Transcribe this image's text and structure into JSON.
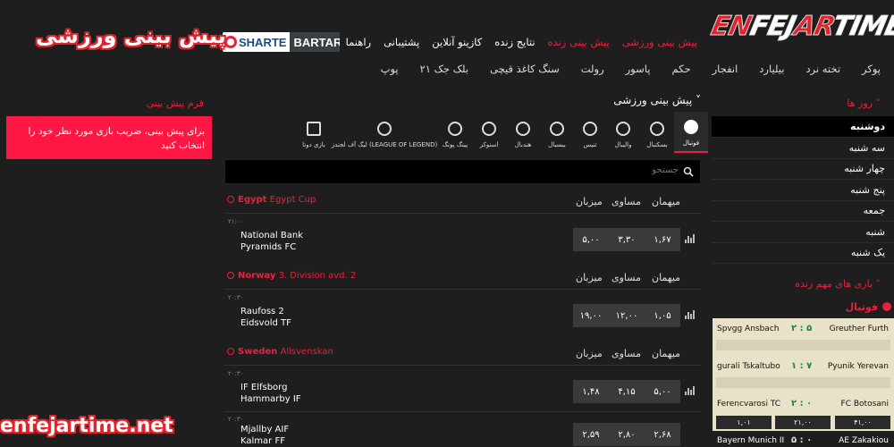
{
  "logo": {
    "part1": "EN",
    "part2": "FEJ",
    "part3": "AR",
    "part4": "TIME"
  },
  "nav_main": [
    "پیش بینی ورزشی",
    "پیش بینی زنده",
    "نتایج زنده",
    "کازینو آنلاین",
    "پشتیبانی",
    "راهنما"
  ],
  "nav_games_row1": [
    "پوکر",
    "تخته نرد",
    "بیلیارد",
    "انفجار",
    "حکم",
    "پاسور",
    "رولت",
    "سنگ کاغذ قیچی",
    "بلک جک ۲۱"
  ],
  "nav_games_row2": [
    "پوپ"
  ],
  "brand": {
    "s": "SHARTE",
    "b": "BARTAR"
  },
  "big_title": "پیش بینی ورزشی",
  "bet_form": {
    "title": "فرم پیش بینی",
    "message": "برای پیش بینی، ضریب بازی مورد نظر خود را انتخاب کنید"
  },
  "sports_heading": "پیش بینی ورزشی ˅",
  "sports": [
    "فوتبال",
    "بسکتبال",
    "والیبال",
    "تنیس",
    "بیسبال",
    "هندبال",
    "اسنوکر",
    "پینگ پونگ",
    "لیگ آف لجندز (LEAGUE OF LEGEND)",
    "بازی دوتا"
  ],
  "search": {
    "placeholder": "جستجو"
  },
  "columns": {
    "away": "میهمان",
    "draw": "مساوی",
    "home": "میزبان"
  },
  "leagues": [
    {
      "country": "Egypt",
      "name": "Egypt Cup",
      "matches": [
        {
          "time": "۲۱:۰۰",
          "team1": "National Bank",
          "team2": "Pyramids FC",
          "odds": [
            "۱,۶۷",
            "۳,۳۰",
            "۵,۰۰"
          ]
        }
      ]
    },
    {
      "country": "Norway",
      "name": "3. Division avd. 2",
      "matches": [
        {
          "time": "۲۰:۳۰",
          "team1": "Raufoss 2",
          "team2": "Eidsvold TF",
          "odds": [
            "۱,۰۵",
            "۱۲,۰۰",
            "۱۹,۰۰"
          ]
        }
      ]
    },
    {
      "country": "Sweden",
      "name": "Allsvenskan",
      "matches": [
        {
          "time": "۲۰:۳۰",
          "team1": "IF Elfsborg",
          "team2": "Hammarby IF",
          "odds": [
            "۵,۰۰",
            "۴,۱۵",
            "۱,۴۸"
          ]
        },
        {
          "time": "۲۰:۳۰",
          "team1": "Mjallby AIF",
          "team2": "Kalmar FF",
          "odds": [
            "۲,۶۸",
            "۲,۸۰",
            "۲,۵۹"
          ]
        }
      ]
    }
  ],
  "days": {
    "title": "روز ها ˅",
    "items": [
      "دوشنبه",
      "سه شنبه",
      "چهار شنبه",
      "پنج شنبه",
      "جمعه",
      "شنبه",
      "یک شنبه"
    ],
    "active_index": 0
  },
  "live": {
    "title": "بازی های مهم زنده ˅",
    "sport": "فوتبال",
    "matches": [
      {
        "home": "Spvgg Ansbach",
        "score": "۲ : ۵",
        "away": "Greuther Furth",
        "odds": []
      },
      {
        "home": "gurali Tskaltubo",
        "score": "۱ : ۷",
        "away": "Pyunik Yerevan",
        "odds": []
      },
      {
        "home": "Ferencvarosi TC",
        "score": "۲ : ۰",
        "away": "FC Botosani",
        "odds": [
          "۱,۰۱",
          "۲۱,۰۰",
          "۴۱,۰۰"
        ]
      },
      {
        "home": "Bayern Munich II",
        "score": "۵ : ۰",
        "away": "AE Zakakiou",
        "odds": []
      }
    ]
  },
  "watermark": "enfejartime.net",
  "colors": {
    "accent": "#e8213f",
    "bg": "#1e1e1e",
    "odd_bg": "#3a3a3a",
    "live_bg": "#e8e2c8"
  }
}
